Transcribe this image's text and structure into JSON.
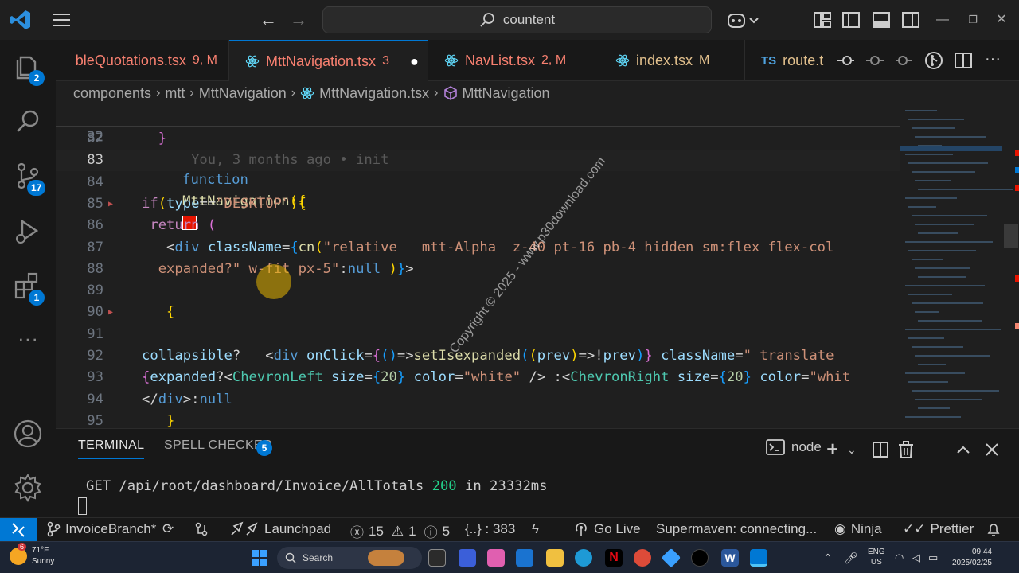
{
  "titlebar": {
    "search_text": "countent"
  },
  "activity": {
    "explorer_badge": "2",
    "scm_badge": "17",
    "extensions_badge": "1"
  },
  "tabs": [
    {
      "name": "bleQuotations.tsx",
      "mark": "9, M"
    },
    {
      "name": "MttNavigation.tsx",
      "mark": "3"
    },
    {
      "name": "NavList.tsx",
      "mark": "2, M"
    },
    {
      "name": "index.tsx",
      "mark": "M"
    },
    {
      "name": "route.t",
      "prefix": "TS"
    }
  ],
  "breadcrumbs": [
    "components",
    "mtt",
    "MttNavigation",
    "MttNavigation.tsx",
    "MttNavigation"
  ],
  "editor": {
    "sticky_line_number": "32",
    "sticky_keyword": "function",
    "sticky_fn": "MttNavigation",
    "sticky_paren": "({",
    "lines": [
      {
        "n": "82",
        "parts": [
          [
            "br2",
            "  }"
          ]
        ]
      },
      {
        "n": "83",
        "parts": [
          [
            "blame",
            "      You, 3 months ago • init"
          ]
        ]
      },
      {
        "n": "84",
        "parts": []
      },
      {
        "n": "85",
        "parts": [
          [
            "kw",
            "if"
          ],
          [
            "br1",
            "("
          ],
          [
            "var",
            "type"
          ],
          [
            "pl",
            "=="
          ],
          [
            "str",
            "\"DESKTOP\""
          ],
          [
            "br1",
            ")"
          ],
          [
            "br1",
            "{"
          ]
        ]
      },
      {
        "n": "86",
        "parts": [
          [
            "pl",
            " "
          ],
          [
            "kw",
            "return"
          ],
          [
            "pl",
            " "
          ],
          [
            "br2",
            "("
          ]
        ]
      },
      {
        "n": "87",
        "parts": [
          [
            "pl",
            "   <"
          ],
          [
            "tag",
            "div"
          ],
          [
            "pl",
            " "
          ],
          [
            "attr",
            "className"
          ],
          [
            "pl",
            "="
          ],
          [
            "br3",
            "{"
          ],
          [
            "fn",
            "cn"
          ],
          [
            "br1",
            "("
          ],
          [
            "str",
            "\"relative   mtt-Alpha  z-40 pt-16 pb-4 hidden sm:flex flex-col"
          ]
        ]
      },
      {
        "n": "88",
        "parts": [
          [
            "str",
            "  expanded?\" w-fit px-5\""
          ],
          [
            "pl",
            ":"
          ],
          [
            "k",
            "null"
          ],
          [
            "pl",
            " "
          ],
          [
            "br1",
            ")"
          ],
          [
            "br3",
            "}"
          ],
          [
            "pl",
            ">"
          ]
        ]
      },
      {
        "n": "89",
        "parts": []
      },
      {
        "n": "90",
        "parts": [
          [
            "br1",
            "   {"
          ]
        ]
      },
      {
        "n": "91",
        "parts": []
      },
      {
        "n": "92",
        "parts": [
          [
            "var",
            "collapsible"
          ],
          [
            "pl",
            "?   <"
          ],
          [
            "tag",
            "div"
          ],
          [
            "pl",
            " "
          ],
          [
            "attr",
            "onClick"
          ],
          [
            "pl",
            "="
          ],
          [
            "br2",
            "{"
          ],
          [
            "br3",
            "()"
          ],
          [
            "pl",
            "=>"
          ],
          [
            "fn",
            "setIsexpanded"
          ],
          [
            "br3",
            "("
          ],
          [
            "br1",
            "("
          ],
          [
            "var",
            "prev"
          ],
          [
            "br1",
            ")"
          ],
          [
            "pl",
            "=>!"
          ],
          [
            "var",
            "prev"
          ],
          [
            "br3",
            ")"
          ],
          [
            "br2",
            "}"
          ],
          [
            "pl",
            " "
          ],
          [
            "attr",
            "className"
          ],
          [
            "pl",
            "="
          ],
          [
            "str",
            "\" translate"
          ]
        ]
      },
      {
        "n": "93",
        "parts": [
          [
            "br2",
            "{"
          ],
          [
            "var",
            "expanded"
          ],
          [
            "pl",
            "?<"
          ],
          [
            "comp",
            "ChevronLeft"
          ],
          [
            "pl",
            " "
          ],
          [
            "attr",
            "size"
          ],
          [
            "pl",
            "="
          ],
          [
            "br3",
            "{"
          ],
          [
            "num",
            "20"
          ],
          [
            "br3",
            "}"
          ],
          [
            "pl",
            " "
          ],
          [
            "attr",
            "color"
          ],
          [
            "pl",
            "="
          ],
          [
            "str",
            "\"white\""
          ],
          [
            "pl",
            " /> :<"
          ],
          [
            "comp",
            "ChevronRight"
          ],
          [
            "pl",
            " "
          ],
          [
            "attr",
            "size"
          ],
          [
            "pl",
            "="
          ],
          [
            "br3",
            "{"
          ],
          [
            "num",
            "20"
          ],
          [
            "br3",
            "}"
          ],
          [
            "pl",
            " "
          ],
          [
            "attr",
            "color"
          ],
          [
            "pl",
            "="
          ],
          [
            "str",
            "\"whit"
          ]
        ]
      },
      {
        "n": "94",
        "parts": [
          [
            "pl",
            "</"
          ],
          [
            "tag",
            "div"
          ],
          [
            "pl",
            ">:"
          ],
          [
            "k",
            "null"
          ]
        ]
      },
      {
        "n": "95",
        "parts": [
          [
            "br1",
            "   }"
          ]
        ]
      }
    ],
    "watermark": "Copyright © 2025 - www.p30download.com"
  },
  "panel": {
    "tab_terminal": "TERMINAL",
    "tab_spell": "SPELL CHECKER",
    "spell_badge": "5",
    "shell": "node",
    "term_prefix": "GET /api/root/dashboard/Invoice/AllTotals ",
    "term_status": "200",
    "term_suffix": " in 23332ms"
  },
  "statusbar": {
    "branch": "InvoiceBranch*",
    "launchpad": "Launchpad",
    "errors": "15",
    "warnings": "1",
    "infos": "5",
    "position": "{..} : 383",
    "golive": "Go Live",
    "supermaven": "Supermaven: connecting...",
    "ninja": "Ninja",
    "prettier": "Prettier"
  },
  "taskbar": {
    "weather_badge": "6",
    "temp": "71°F",
    "condition": "Sunny",
    "search": "Search",
    "lang1": "ENG",
    "lang2": "US",
    "time": "09:44",
    "date": "2025/02/25"
  },
  "colors": {
    "accent": "#0078d4",
    "modified": "#e2c08d",
    "error": "#f88070"
  }
}
